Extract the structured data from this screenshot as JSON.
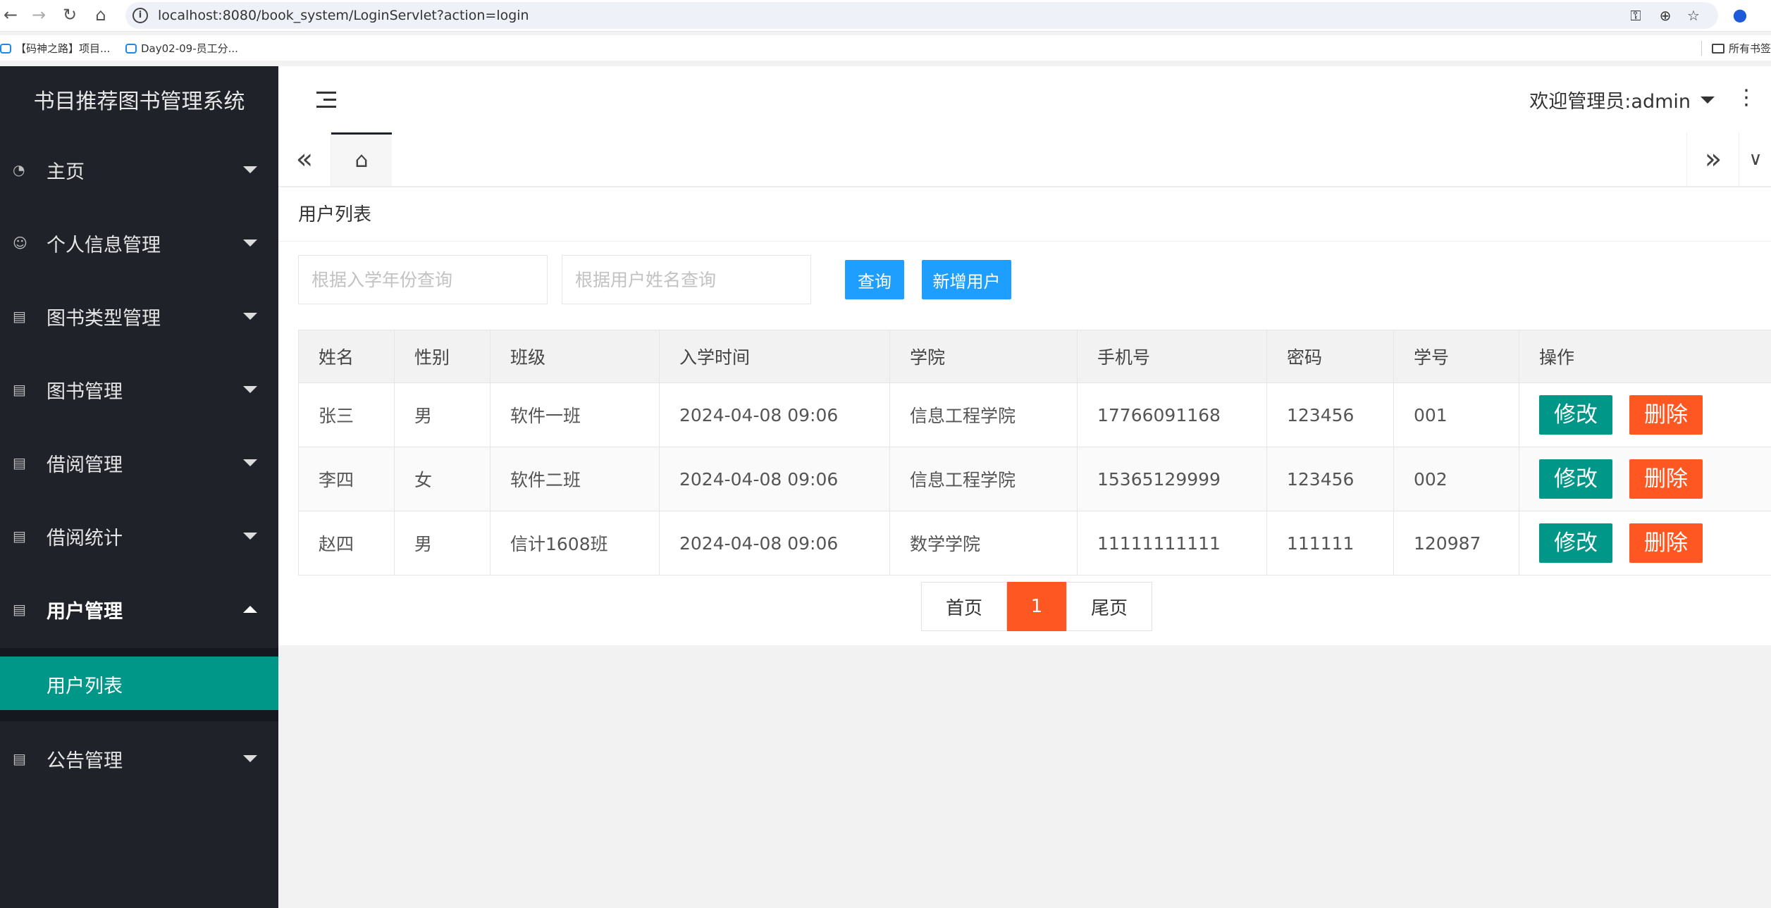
{
  "browser": {
    "url": "localhost:8080/book_system/LoginServlet?action=login",
    "bookmarks": [
      "【码神之路】项目...",
      "Day02-09-员工分..."
    ],
    "bookmarks_right": "所有书签"
  },
  "app": {
    "title": "书目推荐图书管理系统",
    "welcome": "欢迎管理员:admin"
  },
  "sidebar": {
    "items": [
      {
        "label": "主页",
        "icon": "dashboard-icon"
      },
      {
        "label": "个人信息管理",
        "icon": "user-icon"
      },
      {
        "label": "图书类型管理",
        "icon": "file-icon"
      },
      {
        "label": "图书管理",
        "icon": "file-icon"
      },
      {
        "label": "借阅管理",
        "icon": "file-icon"
      },
      {
        "label": "借阅统计",
        "icon": "file-icon"
      },
      {
        "label": "用户管理",
        "icon": "file-icon",
        "expanded": true
      },
      {
        "label": "公告管理",
        "icon": "file-icon"
      }
    ],
    "active_sub": "用户列表"
  },
  "page": {
    "title": "用户列表",
    "search_year_placeholder": "根据入学年份查询",
    "search_name_placeholder": "根据用户姓名查询",
    "query_label": "查询",
    "add_label": "新增用户"
  },
  "table": {
    "headers": [
      "姓名",
      "性别",
      "班级",
      "入学时间",
      "学院",
      "手机号",
      "密码",
      "学号",
      "操作"
    ],
    "rows": [
      [
        "张三",
        "男",
        "软件一班",
        "2024-04-08 09:06",
        "信息工程学院",
        "17766091168",
        "123456",
        "001"
      ],
      [
        "李四",
        "女",
        "软件二班",
        "2024-04-08 09:06",
        "信息工程学院",
        "15365129999",
        "123456",
        "002"
      ],
      [
        "赵四",
        "男",
        "信计1608班",
        "2024-04-08 09:06",
        "数学学院",
        "11111111111",
        "111111",
        "120987"
      ]
    ],
    "edit_label": "修改",
    "delete_label": "删除"
  },
  "pagination": {
    "first": "首页",
    "current": "1",
    "last": "尾页"
  },
  "colors": {
    "sidebar_bg": "#20222a",
    "accent_teal": "#009688",
    "accent_orange": "#ff5722",
    "primary_blue": "#1e9fff"
  }
}
